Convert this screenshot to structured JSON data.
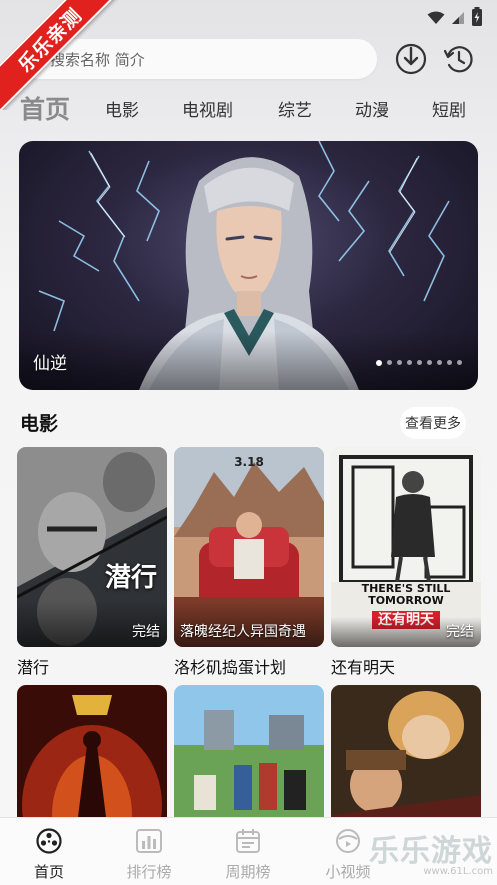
{
  "ribbon": {
    "text": "乐乐亲测"
  },
  "search": {
    "placeholder": "搜索名称 简介"
  },
  "top_icons": [
    "download-history-icon",
    "watch-history-icon"
  ],
  "tabs": [
    {
      "label": "首页",
      "active": true
    },
    {
      "label": "电影"
    },
    {
      "label": "电视剧"
    },
    {
      "label": "综艺"
    },
    {
      "label": "动漫"
    },
    {
      "label": "短剧"
    }
  ],
  "banner": {
    "title": "仙逆",
    "slide_count": 9,
    "active_slide": 0
  },
  "section": {
    "title": "电影",
    "more_label": "查看更多"
  },
  "movies": [
    {
      "title": "潜行",
      "badge": "完结",
      "poster_text": "潜行",
      "caption": ""
    },
    {
      "title": "洛杉矶捣蛋计划",
      "badge": "",
      "poster_text": "3.18",
      "caption": "落魄经纪人异国奇遇"
    },
    {
      "title": "还有明天",
      "badge": "完结",
      "poster_text": "THERE'S STILL TOMORROW",
      "poster_text_cn": "还有明天",
      "caption": ""
    },
    {
      "title": "",
      "badge": "",
      "caption": ""
    },
    {
      "title": "",
      "badge": "",
      "caption": ""
    },
    {
      "title": "",
      "badge": "",
      "caption": ""
    }
  ],
  "bottom_nav": [
    {
      "label": "首页",
      "icon": "home-film-reel-icon",
      "active": true
    },
    {
      "label": "排行榜",
      "icon": "chart-bars-icon"
    },
    {
      "label": "周期榜",
      "icon": "calendar-icon"
    },
    {
      "label": "小视频",
      "icon": "small-video-icon"
    }
  ],
  "watermark": {
    "text": "乐乐游戏",
    "url": "www.61L.com"
  }
}
